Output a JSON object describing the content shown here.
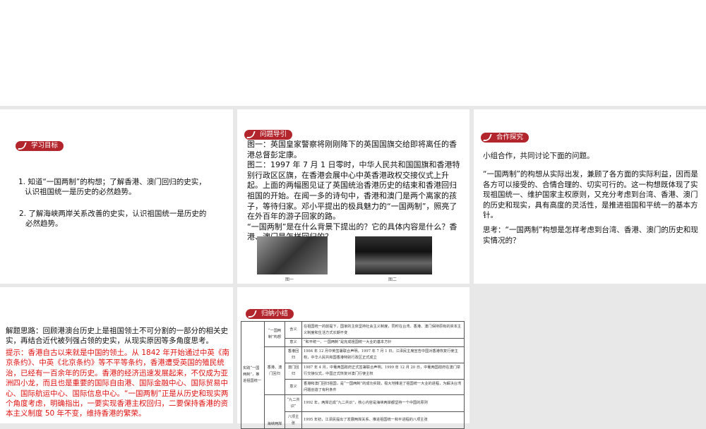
{
  "goals": {
    "badge": "学习目标",
    "items": [
      "1. 知道“一国两制”的构想；了解香港、澳门回归的史实，认识祖国统一是历史的必然趋势。",
      "2. 了解海峡两岸关系改善的史实，认识祖国统一是历史的必然趋势。"
    ]
  },
  "guide": {
    "badge": "问题导引",
    "text": "图一：英国皇家警察将刚刚降下的英国国旗交给即将离任的香港总督彭定康。\n图二：1997 年 7 月 1 日零时，中华人民共和国国旗和香港特别行政区区旗，在香港会展中心中英香港政权交接仪式上升起。上面的两幅图见证了英国统治香港历史的结束和香港回归祖国的开始。在闻一多的诗句中，香港和澳门是两个离家的孩子，等待归家。邓小平提出的极具魅力的“一国两制”，照亮了在外百年的游子回家的路。\n“一国两制”是在什么背景下提出的？它的具体内容是什么？香港、澳门是怎样回归的？",
    "caption1": "图一",
    "caption2": "图二"
  },
  "coop": {
    "badge": "合作探究",
    "p1": "小组合作，共同讨论下面的问题。",
    "p2": "“一国两制”的构想从实际出发，兼顾了各方面的实际利益，因而是各方可以接受的、合情合理的、切实可行的。这一构想既体现了实现祖国统一、维护国家主权原则，又充分考虑到台湾、香港、澳门的历史和现实，具有高度的灵活性，是推进祖国和平统一的基本方针。",
    "p3": "思考：“一国两制”构想是怎样考虑到台湾、香港、澳门的历史和现实情况的？"
  },
  "solution": {
    "idea": "解题思路：回顾港澳台历史上是祖国领土不可分割的一部分的相关史实，再结合近代被列强占领的史实，从现实原因等多角度思考。",
    "hint": "提示：香港自古以来就是中国的领土。从 1842 年开始通过中英《南京条约》、中英《北京条约》等不平等条约，香港遭受英国的殖民统治，已经有一百余年的历史。香港的经济迅速发展起来，不仅成为亚洲四小龙，而且也是重要的国际自由港、国际金融中心、国际贸易中心、国际航运中心、国际信息中心。“一国两制”正是从历史和现实两个角度考虑，明确指出，一要实现香港主权回归，二要保持香港的资本主义制度 50 年不变，维持香港的繁荣。"
  },
  "summary": {
    "badge": "归纳小结",
    "root": "实践“一国两制”，推进祖国统一",
    "g1": "“一国两制”构想",
    "g2": "香港、澳门回归",
    "g3": "海峡两岸",
    "rows": [
      {
        "k": "含义",
        "v": "在祖国统一的前提下，国家的主体坚持社会主义制度，同时在台湾、香港、澳门保持原有的资本主义制度和生活方式长期不变"
      },
      {
        "k": "意义",
        "v": "“和平统一、一国两制”是完成祖国统一大业的基本方针"
      },
      {
        "k": "香港回归",
        "v": "1984 年 12 月中英签署联合声明。1997 年 7 月 1 日，江泽民主席宣告中国对香港恢复行使主权，中华人民共和国香港特别行政区正式成立"
      },
      {
        "k": "澳门回归",
        "v": "1987 年 4 月，中葡两国政府正式签署联合声明。1999 年 12 月 20 日，中葡两国政府在澳门举行交接仪式，中国正式恢复对澳门行使主权"
      },
      {
        "k": "意义",
        "v": "香港和澳门回归祖国，是“一国两制”的成功实践，极大地推进了祖国统一大业的进程，为解决台湾问题创造了有利条件"
      },
      {
        "k": "“九二共识”",
        "v": "1992 年，两岸达成“九二共识”，核心内容是海峡两岸都坚持一个中国的原则"
      },
      {
        "k": "八项主张",
        "v": "1995 年初，江泽民提出了发展两岸关系、推进祖国统一和平进程的八项主张"
      }
    ]
  }
}
